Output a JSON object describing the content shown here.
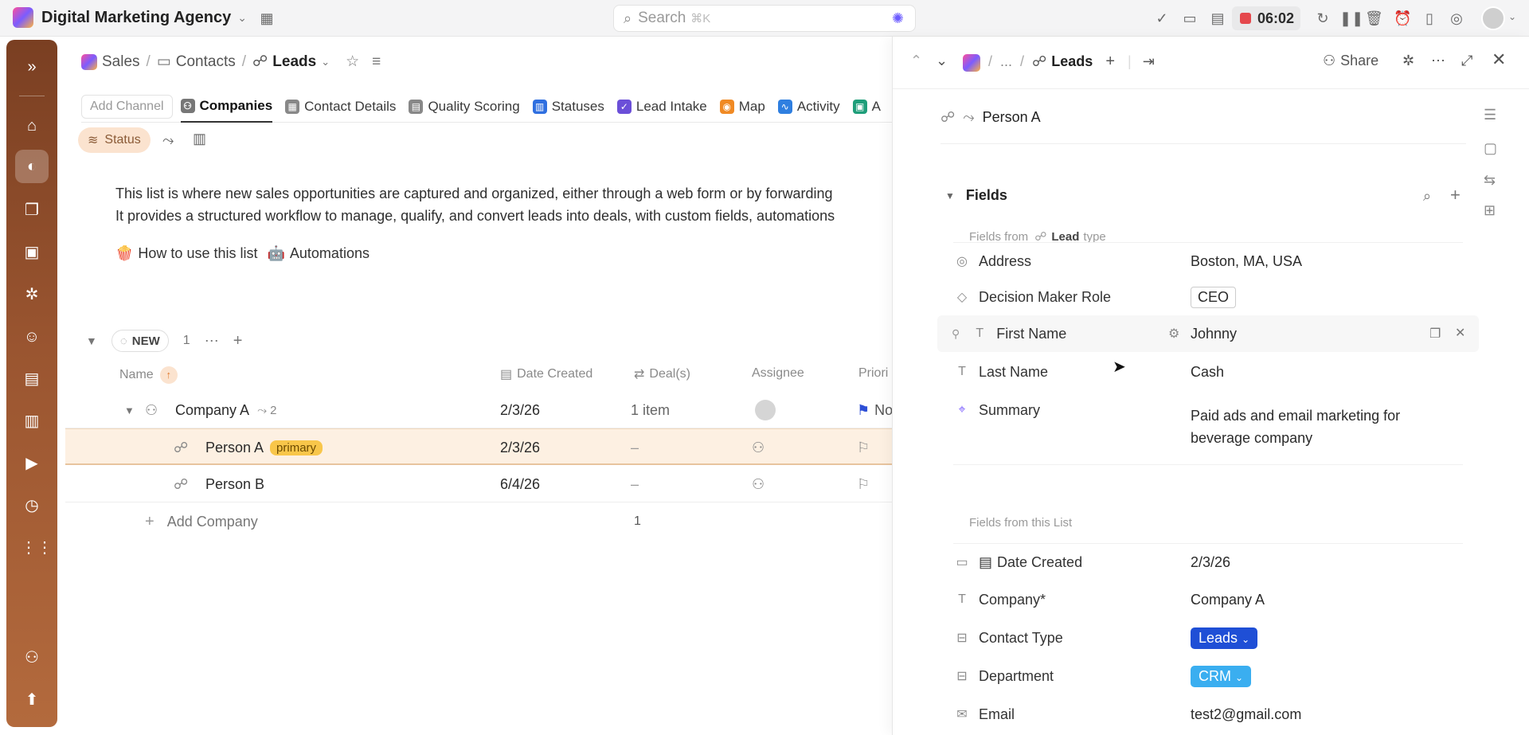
{
  "topbar": {
    "workspace": "Digital Marketing Agency",
    "search_placeholder": "Search",
    "search_shortcut": "⌘K",
    "timer": "06:02"
  },
  "breadcrumb": {
    "sales": "Sales",
    "contacts": "Contacts",
    "leads": "Leads"
  },
  "tabs": {
    "add_channel": "Add Channel",
    "items": [
      "Companies",
      "Contact Details",
      "Quality Scoring",
      "Statuses",
      "Lead Intake",
      "Map",
      "Activity",
      "A"
    ]
  },
  "filters": {
    "status": "Status"
  },
  "description": {
    "line1": "This list is where new sales opportunities are captured and organized, either through a web form or by forwarding",
    "line2": "It provides a structured workflow to manage, qualify, and convert leads into deals, with custom fields, automations"
  },
  "links": {
    "how_to": "How to use this list",
    "automations": "Automations"
  },
  "group": {
    "status": "NEW",
    "count": "1"
  },
  "columns": {
    "name": "Name",
    "date_created": "Date Created",
    "deals": "Deal(s)",
    "assignee": "Assignee",
    "priority": "Priori"
  },
  "rows": [
    {
      "name": "Company A",
      "subcount": "2",
      "date": "2/3/26",
      "deals": "1 item",
      "priority": "No"
    },
    {
      "name": "Person A",
      "badge": "primary",
      "date": "2/3/26",
      "deals": "–"
    },
    {
      "name": "Person B",
      "date": "6/4/26",
      "deals": "–"
    }
  ],
  "add_company": {
    "label": "Add Company",
    "count": "1"
  },
  "panel": {
    "crumb_ellipsis": "...",
    "crumb_leads": "Leads",
    "share": "Share",
    "record_name": "Person A",
    "fields_title": "Fields",
    "fields_from_prefix": "Fields from",
    "fields_from_type": "Lead",
    "fields_from_suffix": "type",
    "lead_fields": [
      {
        "label": "Address",
        "value": "Boston, MA, USA"
      },
      {
        "label": "Decision Maker Role",
        "value": "CEO"
      },
      {
        "label": "First Name",
        "value": "Johnny"
      },
      {
        "label": "Last Name",
        "value": "Cash"
      },
      {
        "label": "Summary",
        "value_line1": "Paid ads and email marketing for",
        "value_line2": "beverage company"
      }
    ],
    "list_fields_title": "Fields from this List",
    "list_fields": [
      {
        "label": "Date Created",
        "value": "2/3/26"
      },
      {
        "label": "Company*",
        "value": "Company A"
      },
      {
        "label": "Contact Type",
        "value": "Leads"
      },
      {
        "label": "Department",
        "value": "CRM"
      },
      {
        "label": "Email",
        "value": "test2@gmail.com"
      }
    ]
  },
  "colors": {
    "accent_rail": "#9a5530",
    "highlight_row": "#fdf0e2",
    "primary_badge": "#f8c64a",
    "leads_pill": "#1f4fd6",
    "crm_pill": "#3aaef0"
  }
}
